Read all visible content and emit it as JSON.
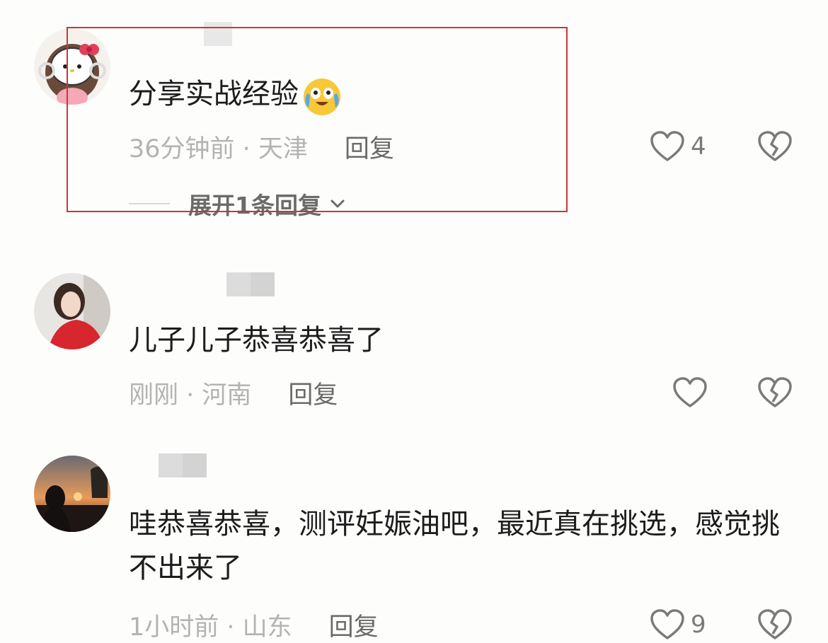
{
  "comments": [
    {
      "content": "分享实战经验",
      "emoji": "crying-laughing-face",
      "time_location": "36分钟前 · 天津",
      "reply_label": "回复",
      "likes": "4",
      "expand_label": "展开1条回复",
      "avatar": "hello-kitty-avatar"
    },
    {
      "content": "儿子儿子恭喜恭喜了",
      "time_location": "刚刚 · 河南",
      "reply_label": "回复",
      "likes": "",
      "avatar": "girl-portrait-avatar"
    },
    {
      "content": "哇恭喜恭喜，测评妊娠油吧，最近真在挑选，感觉挑不出来了",
      "time_location": "1小时前 · 山东",
      "reply_label": "回复",
      "likes": "9",
      "avatar": "sunset-silhouette-avatar"
    }
  ],
  "colors": {
    "highlight_border": "#c23a3a",
    "text_primary": "#1c1c1c",
    "text_meta": "#b3b3b3",
    "icon_stroke": "#7a7a7a"
  }
}
